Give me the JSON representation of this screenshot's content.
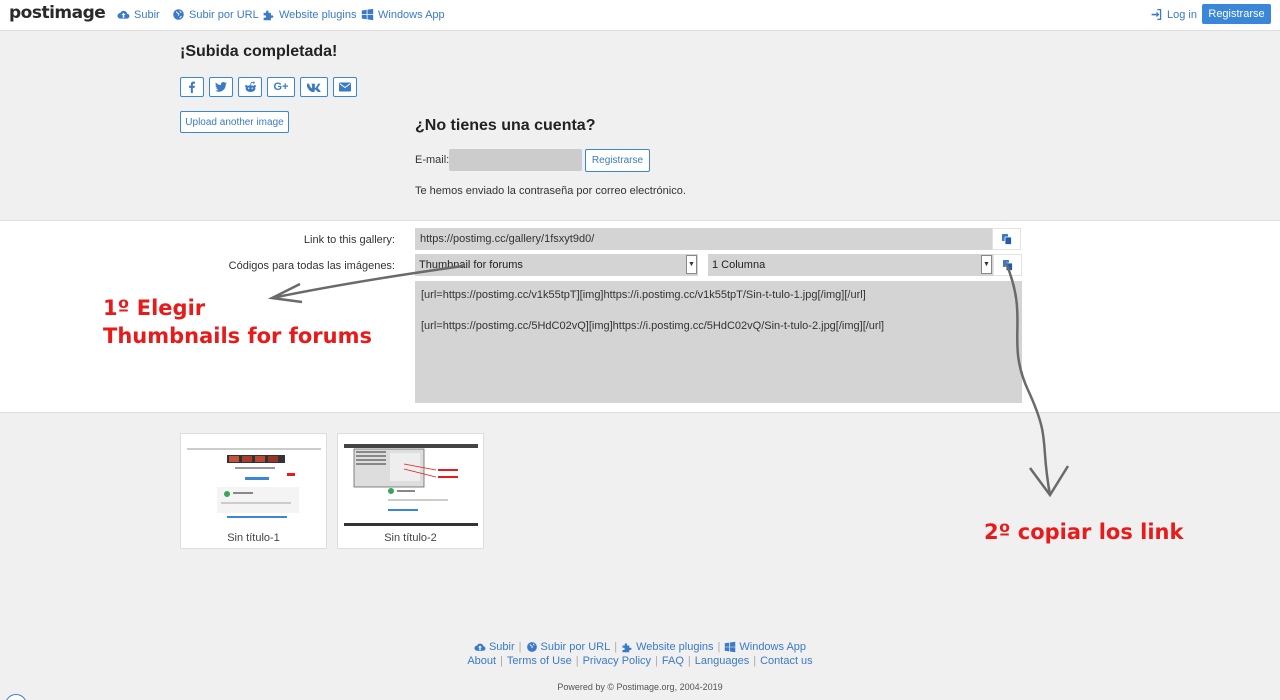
{
  "nav": {
    "logo": "postimage",
    "upload": "Subir",
    "upload_url": "Subir por URL",
    "plugins": "Website plugins",
    "windows_app": "Windows App",
    "login": "Log in",
    "register": "Registrarse"
  },
  "upload": {
    "heading": "¡Subida completada!",
    "share": [
      "f",
      "twitter",
      "reddit",
      "G+",
      "vk",
      "email"
    ],
    "upload_another": "Upload another image"
  },
  "account": {
    "title": "¿No tienes una cuenta?",
    "email_label": "E-mail:",
    "email_value": "",
    "register_button": "Registrarse",
    "note": "Te hemos enviado la contraseña por correo electrónico."
  },
  "links": {
    "gallery_label": "Link to this gallery:",
    "gallery_url": "https://postimg.cc/gallery/1fsxyt9d0/",
    "codes_label": "Códigos para todas las imágenes:",
    "format_selected": "Thumbnail for forums",
    "columns_selected": "1 Columna",
    "codes": [
      "[url=https://postimg.cc/v1k55tpT][img]https://i.postimg.cc/v1k55tpT/Sin-t-tulo-1.jpg[/img][/url]",
      "[url=https://postimg.cc/5HdC02vQ][img]https://i.postimg.cc/5HdC02vQ/Sin-t-tulo-2.jpg[/img][/url]"
    ]
  },
  "thumbnails": [
    {
      "label": "Sin título-1"
    },
    {
      "label": "Sin título-2"
    }
  ],
  "annotations": {
    "step1_line1": "1º Elegir",
    "step1_line2": "Thumbnails for forums",
    "step2": "2º copiar los link",
    "color": "#e81a1a"
  },
  "footer": {
    "upload": "Subir",
    "upload_url": "Subir por URL",
    "plugins": "Website plugins",
    "windows_app": "Windows App",
    "about": "About",
    "terms": "Terms of Use",
    "privacy": "Privacy Policy",
    "faq": "FAQ",
    "languages": "Languages",
    "contact": "Contact us",
    "powered": "Powered by © Postimage.org, 2004-2019"
  },
  "colors": {
    "accent": "#3a86d8",
    "link": "#3a7ac9",
    "page_bg": "#f0f0f0",
    "field_bg": "#d4d4d4"
  }
}
